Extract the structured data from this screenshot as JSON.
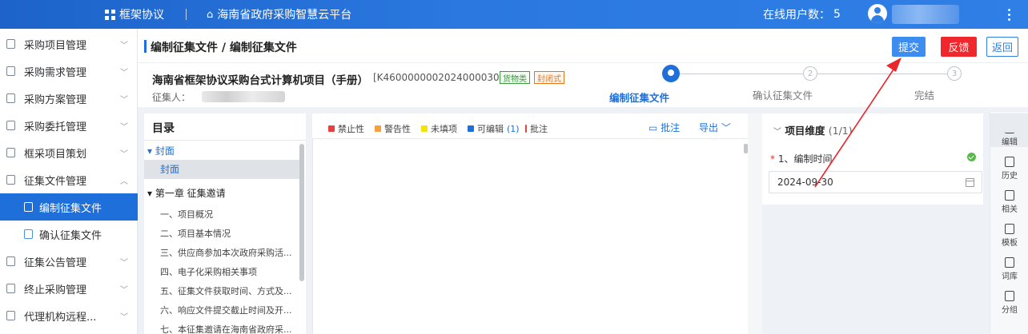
{
  "topbar": {
    "module_label": "框架协议",
    "platform_name": "海南省政府采购智慧云平台",
    "online_users_label": "在线用户数：",
    "online_users_count": "5"
  },
  "sidebar": {
    "items": [
      {
        "label": "采购项目管理",
        "expanded": false
      },
      {
        "label": "采购需求管理",
        "expanded": false
      },
      {
        "label": "采购方案管理",
        "expanded": false
      },
      {
        "label": "采购委托管理",
        "expanded": false
      },
      {
        "label": "框采项目策划",
        "expanded": false
      },
      {
        "label": "征集文件管理",
        "expanded": true
      },
      {
        "label": "征集公告管理",
        "expanded": false
      },
      {
        "label": "终止采购管理",
        "expanded": false
      },
      {
        "label": "代理机构远程...",
        "expanded": false
      }
    ],
    "sub_items": [
      {
        "label": "编制征集文件",
        "active": true
      },
      {
        "label": "确认征集文件",
        "active": false
      }
    ]
  },
  "header": {
    "breadcrumb_title": "编制征集文件 / 编制征集文件",
    "submit_label": "提交",
    "feedback_label": "反馈",
    "back_label": "返回"
  },
  "project": {
    "name": "海南省框架协议采购台式计算机项目（手册）",
    "code": "[K4600000002024000030]",
    "tag_type": "货物类",
    "tag_mode": "封闭式",
    "collector_label": "征集人："
  },
  "steps": [
    {
      "num": "1",
      "label": "编制征集文件",
      "state": "current"
    },
    {
      "num": "2",
      "label": "确认征集文件",
      "state": "pending"
    },
    {
      "num": "3",
      "label": "完结",
      "state": "pending"
    }
  ],
  "toc": {
    "title": "目录",
    "cover_section": "▾ 封面",
    "cover_item": "封面",
    "chapter1": "▾ 第一章 征集邀请",
    "items": [
      "一、项目概况",
      "二、项目基本情况",
      "三、供应商参加本次政府采购活...",
      "四、电子化采购相关事项",
      "五、征集文件获取时间、方式及...",
      "六、响应文件提交截止时间及开...",
      "七、本征集邀请在海南省政府采..."
    ]
  },
  "editor": {
    "legend": [
      {
        "label": "禁止性",
        "color": "#e8403c"
      },
      {
        "label": "警告性",
        "color": "#f5a03a"
      },
      {
        "label": "未填项",
        "color": "#f5e10c"
      },
      {
        "label": "可编辑",
        "color": "#1e6fd9",
        "count": "(1)"
      },
      {
        "label": "批注",
        "color": "#e8403c"
      }
    ],
    "annotate_label": "批注",
    "export_label": "导出"
  },
  "props": {
    "title": "项目维度",
    "count": "(1/1)",
    "field_label": "1、编制时间",
    "field_value": "2024-09-30"
  },
  "rail": {
    "items": [
      "编辑",
      "历史",
      "相关",
      "模板",
      "词库",
      "分组"
    ]
  },
  "colors": {
    "primary": "#1e6fd9",
    "danger": "#f0282d",
    "success": "#59b84a"
  }
}
